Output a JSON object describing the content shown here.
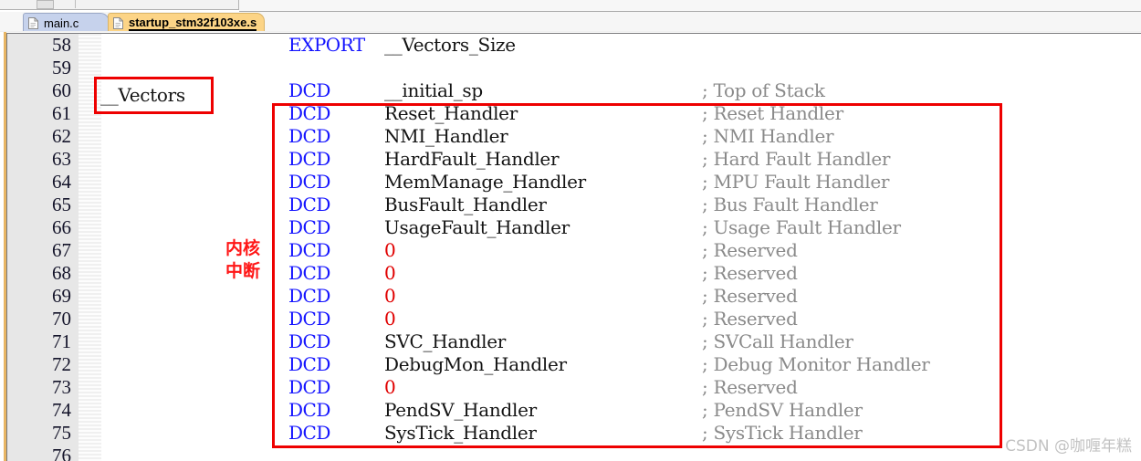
{
  "window": {
    "app_hint": "keil-uvision-editor"
  },
  "tabs": [
    {
      "label": "main.c",
      "active": false,
      "icon": "document-icon"
    },
    {
      "label": "startup_stm32f103xe.s",
      "active": true,
      "icon": "document-icon"
    }
  ],
  "editor": {
    "first_line_number": 58,
    "lines": [
      {
        "num": 58,
        "keyword": "EXPORT",
        "operand": "__Vectors_Size",
        "operand_type": "ident",
        "comment": ""
      },
      {
        "num": 59,
        "keyword": "",
        "operand": "",
        "operand_type": "ident",
        "comment": ""
      },
      {
        "num": 60,
        "keyword": "DCD",
        "operand": "__initial_sp",
        "operand_type": "ident",
        "comment": "; Top of Stack"
      },
      {
        "num": 61,
        "keyword": "DCD",
        "operand": "Reset_Handler",
        "operand_type": "ident",
        "comment": "; Reset Handler"
      },
      {
        "num": 62,
        "keyword": "DCD",
        "operand": "NMI_Handler",
        "operand_type": "ident",
        "comment": "; NMI Handler"
      },
      {
        "num": 63,
        "keyword": "DCD",
        "operand": "HardFault_Handler",
        "operand_type": "ident",
        "comment": "; Hard Fault Handler"
      },
      {
        "num": 64,
        "keyword": "DCD",
        "operand": "MemManage_Handler",
        "operand_type": "ident",
        "comment": "; MPU Fault Handler"
      },
      {
        "num": 65,
        "keyword": "DCD",
        "operand": "BusFault_Handler",
        "operand_type": "ident",
        "comment": "; Bus Fault Handler"
      },
      {
        "num": 66,
        "keyword": "DCD",
        "operand": "UsageFault_Handler",
        "operand_type": "ident",
        "comment": "; Usage Fault Handler"
      },
      {
        "num": 67,
        "keyword": "DCD",
        "operand": "0",
        "operand_type": "num",
        "comment": "; Reserved"
      },
      {
        "num": 68,
        "keyword": "DCD",
        "operand": "0",
        "operand_type": "num",
        "comment": "; Reserved"
      },
      {
        "num": 69,
        "keyword": "DCD",
        "operand": "0",
        "operand_type": "num",
        "comment": "; Reserved"
      },
      {
        "num": 70,
        "keyword": "DCD",
        "operand": "0",
        "operand_type": "num",
        "comment": "; Reserved"
      },
      {
        "num": 71,
        "keyword": "DCD",
        "operand": "SVC_Handler",
        "operand_type": "ident",
        "comment": "; SVCall Handler"
      },
      {
        "num": 72,
        "keyword": "DCD",
        "operand": "DebugMon_Handler",
        "operand_type": "ident",
        "comment": "; Debug Monitor Handler"
      },
      {
        "num": 73,
        "keyword": "DCD",
        "operand": "0",
        "operand_type": "num",
        "comment": "; Reserved"
      },
      {
        "num": 74,
        "keyword": "DCD",
        "operand": "PendSV_Handler",
        "operand_type": "ident",
        "comment": "; PendSV Handler"
      },
      {
        "num": 75,
        "keyword": "DCD",
        "operand": "SysTick_Handler",
        "operand_type": "ident",
        "comment": "; SysTick Handler"
      },
      {
        "num": 76,
        "keyword": "",
        "operand": "",
        "operand_type": "ident",
        "comment": ""
      }
    ]
  },
  "annotations": {
    "vectors_label": "__Vectors",
    "chinese_note": "内核\n中断",
    "chinese_note_line1": "内核",
    "chinese_note_line2": "中断",
    "box_color": "#ee0000",
    "note_color": "#ff1616"
  },
  "watermark": {
    "text": "CSDN @咖喱年糕"
  },
  "colors": {
    "keyword": "#1414ff",
    "identifier": "#141414",
    "number": "#e00000",
    "comment": "#8a8a8a",
    "gutter_bg": "#e7e7e7",
    "active_tab_bg": "#fcd486",
    "inactive_tab_bg": "#c6d2ec",
    "editor_border": "#e8b563"
  }
}
